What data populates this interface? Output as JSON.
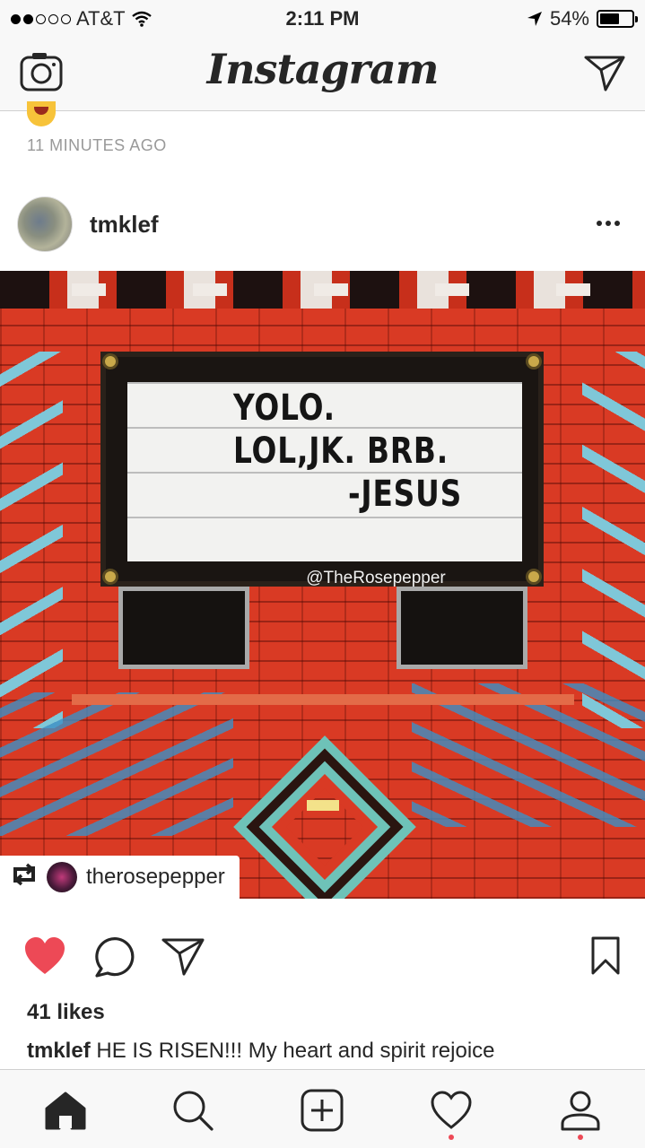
{
  "status_bar": {
    "carrier": "AT&T",
    "time": "2:11 PM",
    "battery": "54%",
    "battery_level": 0.54
  },
  "nav": {
    "logo": "Instagram",
    "left_icon": "camera-icon",
    "right_icon": "direct-message-icon"
  },
  "previous_post": {
    "timestamp": "11 MINUTES AGO"
  },
  "post": {
    "username": "tmklef",
    "image": {
      "sign_lines": [
        "YOLO.",
        "LOL,JK. BRB.",
        "-JESUS"
      ],
      "credit": "@TheRosepepper"
    },
    "repost_username": "therosepepper",
    "liked": true,
    "likes": "41 likes",
    "caption_user": "tmklef",
    "caption_text": "HE IS RISEN!!! My heart and spirit rejoice"
  },
  "tab_bar": {
    "items": [
      "home-icon",
      "search-icon",
      "new-post-icon",
      "activity-icon",
      "profile-icon"
    ]
  },
  "colors": {
    "like_red": "#ed4956",
    "text": "#262626",
    "muted": "#999999"
  }
}
